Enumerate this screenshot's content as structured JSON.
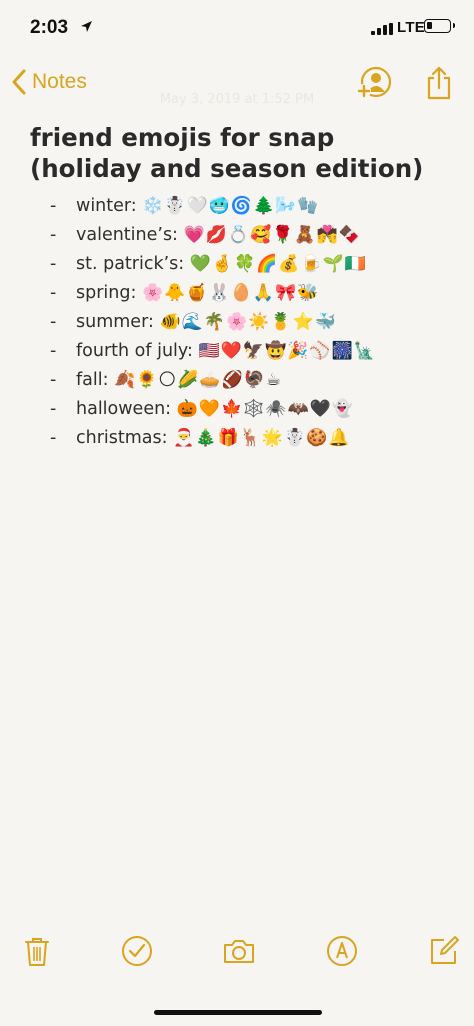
{
  "status": {
    "time": "2:03",
    "network": "LTE",
    "battery_level": 0.25
  },
  "nav": {
    "back_label": "Notes",
    "faint_date": "May 3, 2019 at 1:52 PM"
  },
  "note": {
    "title": "friend emojis for snap (holiday and season edition)",
    "items": [
      {
        "dash": "-",
        "label": "winter:",
        "emojis": "❄️☃️🤍🥶🌀🌲🌬️🧤"
      },
      {
        "dash": "-",
        "label": "valentine’s:",
        "emojis": "💗💋💍🥰🌹🧸💏🍫"
      },
      {
        "dash": "-",
        "label": "st. patrick’s:",
        "emojis": "💚🤞🍀🌈💰🍺🌱🇮🇪"
      },
      {
        "dash": "-",
        "label": "spring:",
        "emojis": "🌸🐥🍯🐰🥚🙏🎀🐝"
      },
      {
        "dash": "-",
        "label": "summer:",
        "emojis": "🐠🌊🌴🌸☀️🍍⭐🐳"
      },
      {
        "dash": "-",
        "label": "fourth of july:",
        "emojis": "🇺🇸❤️🦅🤠🎉⚾🎆🗽"
      },
      {
        "dash": "-",
        "label": "fall:",
        "emojis": "🍂🌻🌕🌽🥧🏈🦃☕"
      },
      {
        "dash": "-",
        "label": "halloween:",
        "emojis": "🎃🧡🍁🕸️🕷️🦇🖤👻"
      },
      {
        "dash": "-",
        "label": "christmas:",
        "emojis": "🎅🎄🎁🦌🌟☃️🍪🔔"
      }
    ]
  },
  "colors": {
    "accent": "#d9a520",
    "background": "#f6f5f1",
    "text": "#2b2b2b"
  },
  "icons": {
    "back": "chevron-left-icon",
    "add_people": "add-person-icon",
    "share": "share-icon",
    "trash": "trash-icon",
    "checklist": "checkmark-circle-icon",
    "camera": "camera-icon",
    "markup": "markup-pen-icon",
    "compose": "compose-icon"
  }
}
